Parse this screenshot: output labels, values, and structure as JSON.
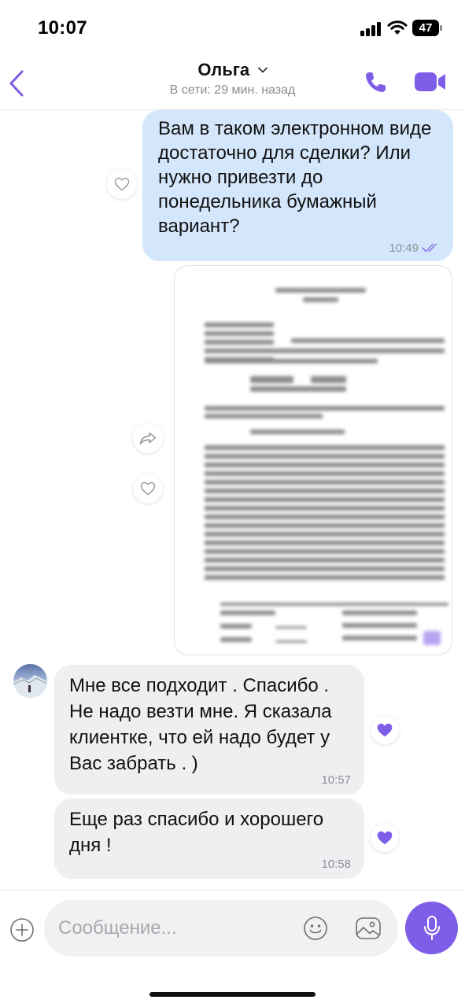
{
  "status_bar": {
    "time": "10:07",
    "battery": "47"
  },
  "header": {
    "contact_name": "Ольга",
    "status": "В сети: 29 мин. назад"
  },
  "messages": {
    "outgoing_1": {
      "text": "Вам в таком электронном виде достаточно для сделки? Или нужно привезти до понедельника бумажный вариант?",
      "time": "10:49"
    },
    "incoming_1": {
      "text": "Мне все подходит . Спасибо . Не надо везти мне. Я сказала клиентке, что ей надо будет у Вас забрать . )",
      "time": "10:57"
    },
    "incoming_2": {
      "text": "Еще раз спасибо и хорошего дня !",
      "time": "10:58"
    }
  },
  "composer": {
    "placeholder": "Сообщение..."
  },
  "colors": {
    "accent": "#7e5ee8",
    "outgoing_bubble": "#d4e6fb",
    "incoming_bubble": "#efeff1"
  },
  "icons": [
    "back-chevron-icon",
    "phone-icon",
    "video-camera-icon",
    "heart-icon",
    "share-icon",
    "double-check-icon",
    "plus-icon",
    "emoji-icon",
    "gallery-icon",
    "microphone-icon"
  ]
}
